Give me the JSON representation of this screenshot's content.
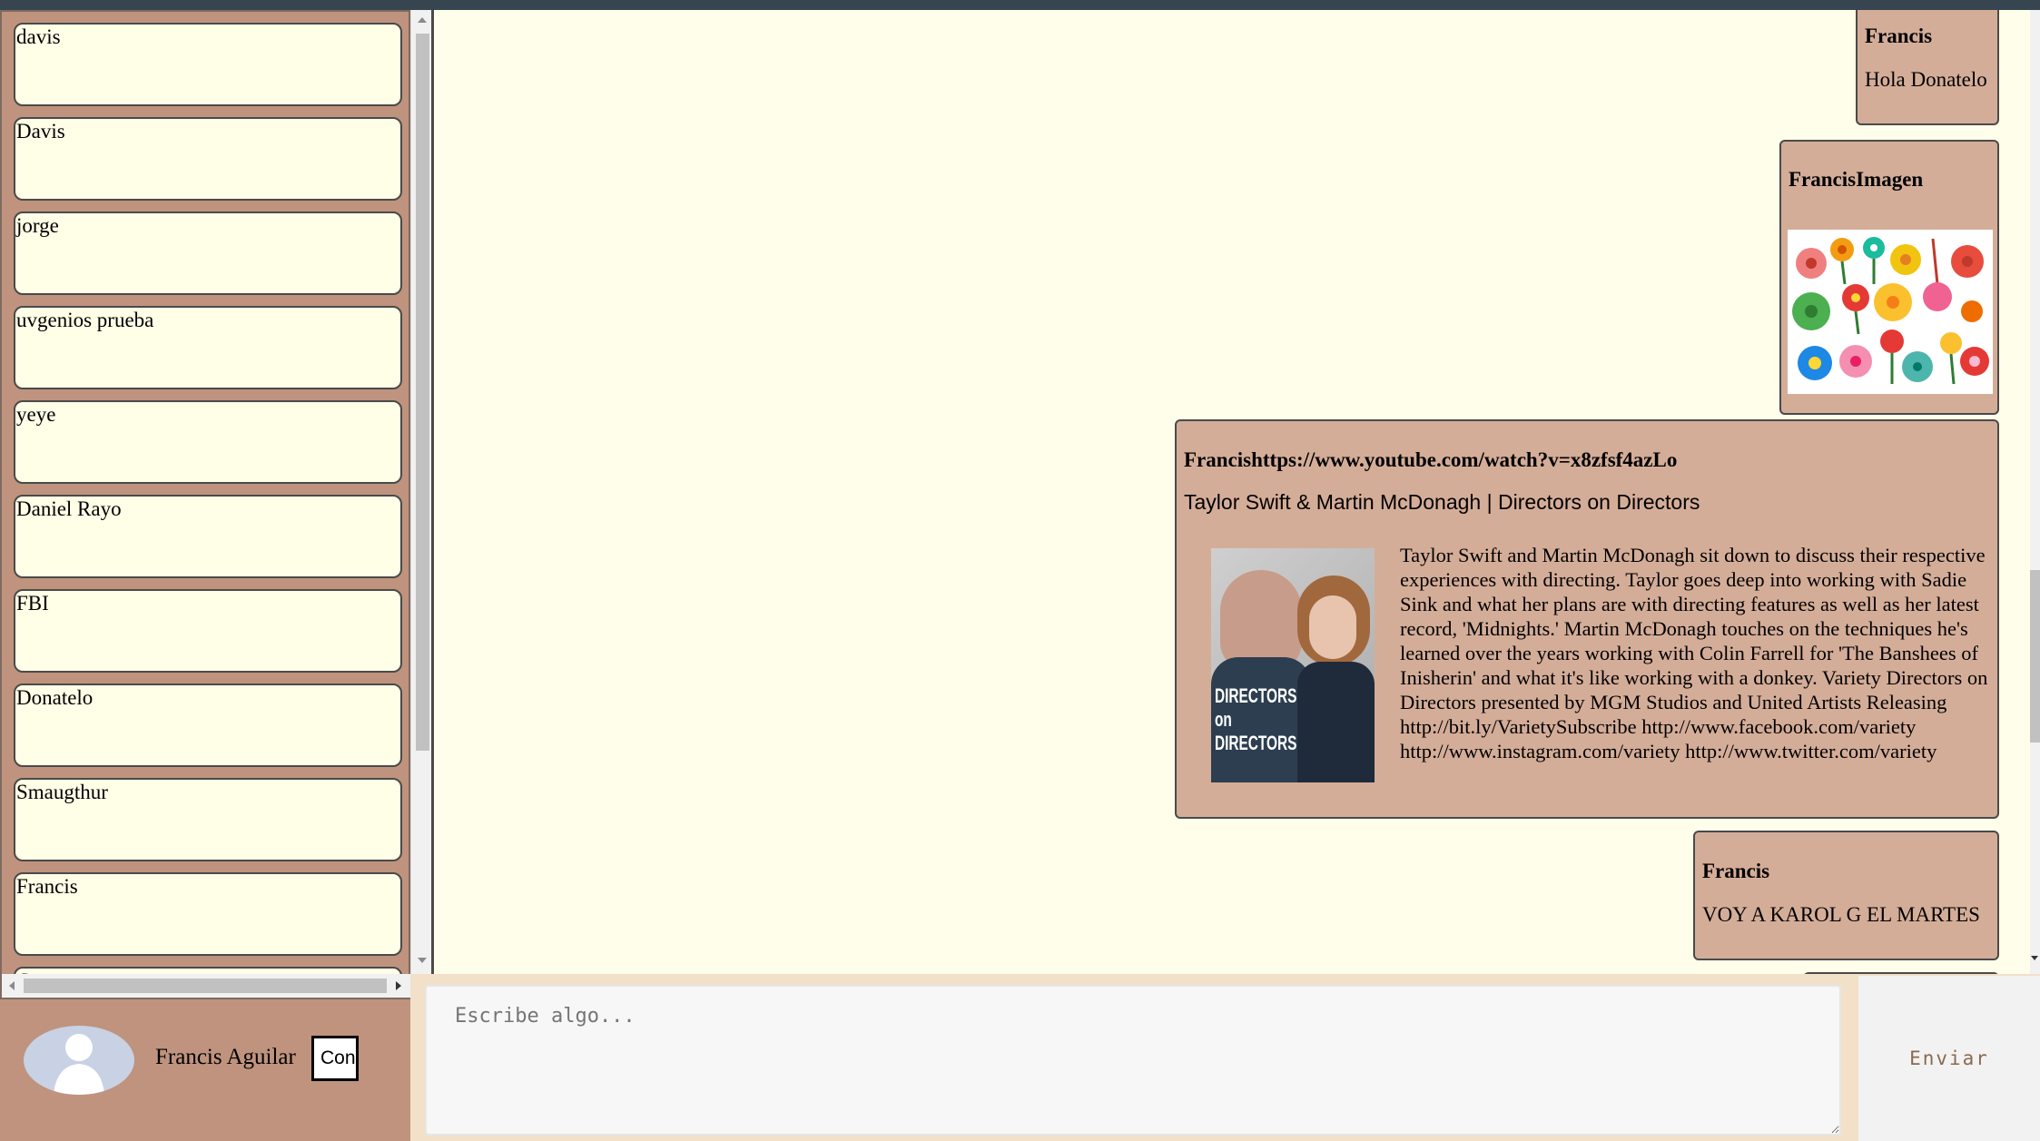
{
  "contacts": [
    {
      "name": "davis"
    },
    {
      "name": "Davis"
    },
    {
      "name": "jorge"
    },
    {
      "name": "uvgenios prueba"
    },
    {
      "name": "yeye"
    },
    {
      "name": "Daniel Rayo"
    },
    {
      "name": "FBI"
    },
    {
      "name": "Donatelo"
    },
    {
      "name": "Smaugthur"
    },
    {
      "name": "Francis"
    },
    {
      "name": "C"
    }
  ],
  "messages": [
    {
      "sender": "Francis",
      "text": "Hola Donatelo"
    },
    {
      "sender": "FrancisImagen",
      "image": "flowers-image"
    },
    {
      "sender": "Francishttps://www.youtube.com/watch?v=x8zfsf4azLo",
      "link_title": "Taylor Swift & Martin McDonagh | Directors on Directors",
      "description": "Taylor Swift and Martin McDonagh sit down to discuss their respective experiences with directing. Taylor goes deep into working with Sadie Sink and what her plans are with directing features as well as her latest record, 'Midnights.' Martin McDonagh touches on the techniques he's learned over the years working with Colin Farrell for 'The Banshees of Inisherin' and what it's like working with a donkey. Variety Directors on Directors presented by MGM Studios and United Artists Releasing http://bit.ly/VarietySubscribe http://www.facebook.com/variety http://www.instagram.com/variety http://www.twitter.com/variety",
      "thumb_text": "DIRECTORS on DIRECTORS"
    },
    {
      "sender": "Francis",
      "text": "VOY A KAROL G EL MARTES"
    }
  ],
  "footer": {
    "user_name": "Francis Aguilar",
    "con_button": "Con",
    "input_placeholder": "Escribe algo...",
    "send_label": "Enviar"
  },
  "colors": {
    "sidebar": "#bf937e",
    "message": "#d4ad98",
    "chat_bg": "#fffeea",
    "contact_bg": "#fffee7"
  }
}
